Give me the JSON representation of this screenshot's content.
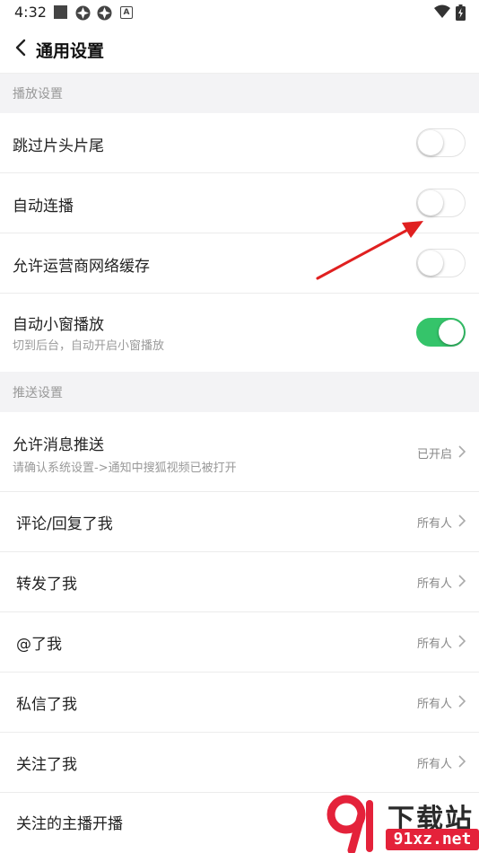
{
  "status": {
    "time": "4:32"
  },
  "header": {
    "title": "通用设置"
  },
  "sections": {
    "playback": "播放设置",
    "push": "推送设置"
  },
  "playback": {
    "skip": {
      "label": "跳过片头片尾",
      "on": false
    },
    "autoplay": {
      "label": "自动连播",
      "on": false
    },
    "cellular": {
      "label": "允许运营商网络缓存",
      "on": false
    },
    "mini": {
      "label": "自动小窗播放",
      "sub": "切到后台，自动开启小窗播放",
      "on": true
    }
  },
  "push": {
    "allow": {
      "label": "允许消息推送",
      "sub": "请确认系统设置->通知中搜狐视频已被打开",
      "value": "已开启"
    },
    "items": [
      {
        "label": "评论/回复了我",
        "value": "所有人"
      },
      {
        "label": "转发了我",
        "value": "所有人"
      },
      {
        "label": "@了我",
        "value": "所有人"
      },
      {
        "label": "私信了我",
        "value": "所有人"
      },
      {
        "label": "关注了我",
        "value": "所有人"
      },
      {
        "label": "关注的主播开播",
        "value": ""
      }
    ]
  },
  "watermark": {
    "top": "下载站",
    "bottom": "91xz.net"
  },
  "colors": {
    "toggle_on": "#35c46a",
    "section_bg": "#f3f3f5",
    "arrow": "#e02020"
  }
}
